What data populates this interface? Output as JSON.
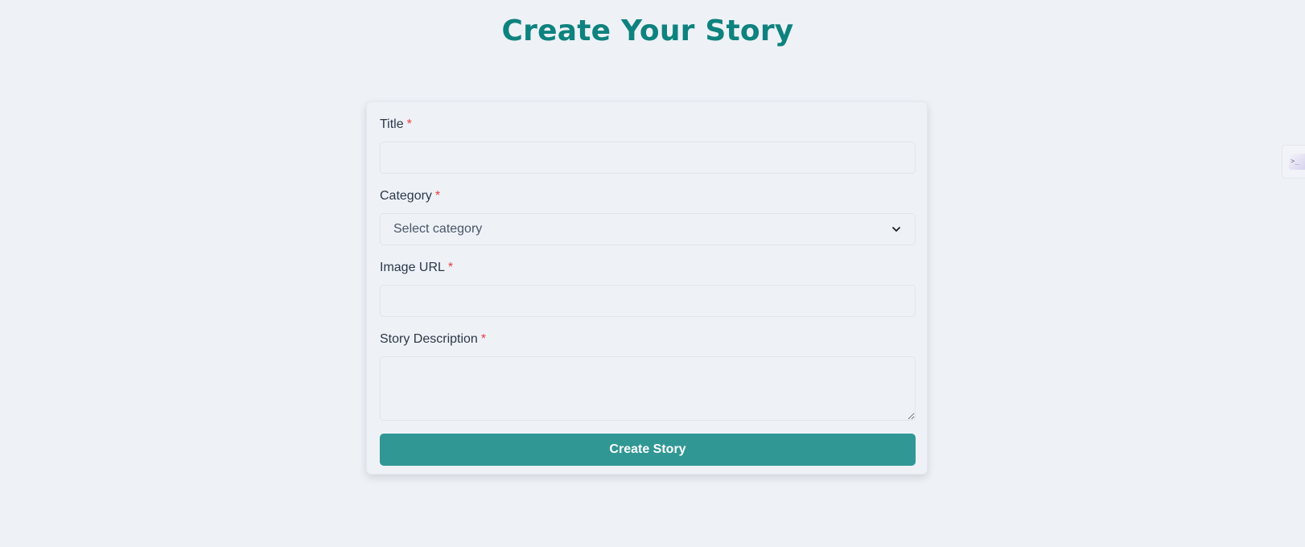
{
  "page": {
    "title": "Create Your Story"
  },
  "form": {
    "fields": {
      "title": {
        "label": "Title",
        "required_mark": "*",
        "value": "",
        "placeholder": ""
      },
      "category": {
        "label": "Category",
        "required_mark": "*",
        "selected": "Select category"
      },
      "image_url": {
        "label": "Image URL",
        "required_mark": "*",
        "value": "",
        "placeholder": ""
      },
      "description": {
        "label": "Story Description",
        "required_mark": "*",
        "value": "",
        "placeholder": ""
      }
    },
    "submit_label": "Create Story"
  },
  "side_widget": {
    "icon": "terminal-icon",
    "text": ">_"
  },
  "colors": {
    "background": "#eef2f7",
    "title": "#0e827e",
    "button": "#319795",
    "required": "#e53e3e"
  }
}
